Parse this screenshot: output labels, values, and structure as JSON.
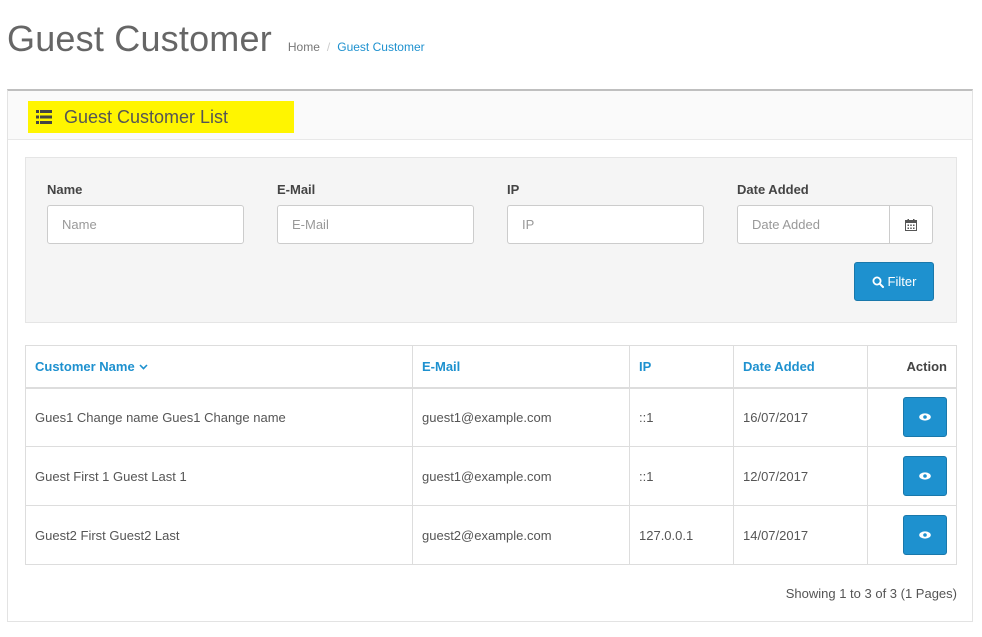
{
  "header": {
    "title": "Guest Customer",
    "breadcrumb": {
      "home": "Home",
      "separator": "/",
      "current": "Guest Customer"
    }
  },
  "panel": {
    "title": "Guest Customer List",
    "highlight_color": "#fff500"
  },
  "filter": {
    "name": {
      "label": "Name",
      "placeholder": "Name",
      "value": ""
    },
    "email": {
      "label": "E-Mail",
      "placeholder": "E-Mail",
      "value": ""
    },
    "ip": {
      "label": "IP",
      "placeholder": "IP",
      "value": ""
    },
    "date_added": {
      "label": "Date Added",
      "placeholder": "Date Added",
      "value": ""
    },
    "calendar_icon": "calendar-icon",
    "button_label": "Filter",
    "button_icon": "search-icon"
  },
  "table": {
    "columns": {
      "name": "Customer Name",
      "email": "E-Mail",
      "ip": "IP",
      "date": "Date Added",
      "action": "Action"
    },
    "sort_icon": "chevron-down-icon",
    "rows": [
      {
        "name": "Gues1 Change name Gues1 Change name",
        "email": "guest1@example.com",
        "ip": "::1",
        "date": "16/07/2017",
        "action_icon": "eye-icon"
      },
      {
        "name": "Guest First 1 Guest Last 1",
        "email": "guest1@example.com",
        "ip": "::1",
        "date": "12/07/2017",
        "action_icon": "eye-icon"
      },
      {
        "name": "Guest2 First Guest2 Last",
        "email": "guest2@example.com",
        "ip": "127.0.0.1",
        "date": "14/07/2017",
        "action_icon": "eye-icon"
      }
    ]
  },
  "pagination": {
    "summary": "Showing 1 to 3 of 3 (1 Pages)"
  },
  "colors": {
    "accent": "#1e91cf",
    "title_text": "#666666"
  }
}
